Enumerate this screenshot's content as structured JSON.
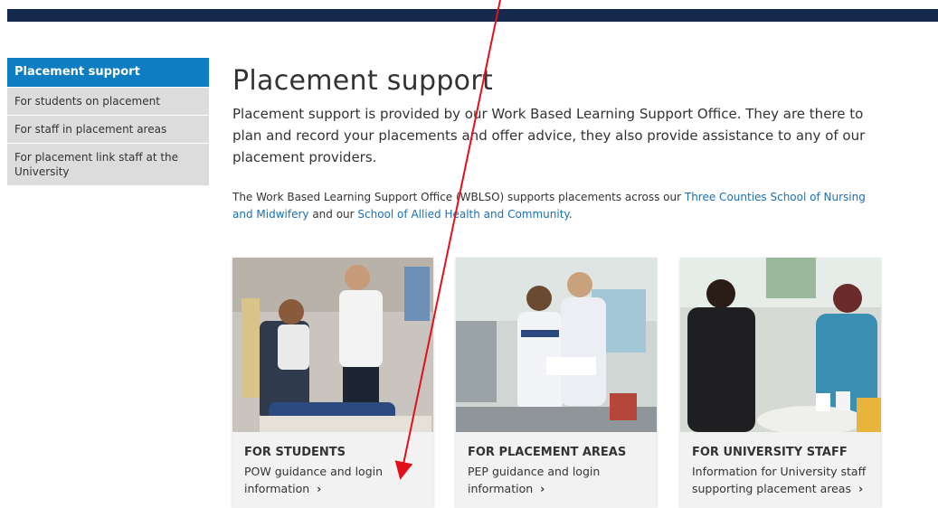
{
  "sidebar": {
    "items": [
      {
        "label": "Placement support"
      },
      {
        "label": "For students on placement"
      },
      {
        "label": "For staff in placement areas"
      },
      {
        "label": "For placement link staff at the University"
      }
    ]
  },
  "main": {
    "title": "Placement support",
    "intro": "Placement support is provided by our Work Based Learning Support Office. They are there to plan and record your placements and offer advice, they also provide assistance to any of our placement providers.",
    "sub_text_1": "The Work Based Learning Support Office (WBLSO) supports placements across our ",
    "sub_link_1": "Three Counties School of Nursing and Midwifery",
    "sub_text_2": " and our ",
    "sub_link_2": "School of Allied Health and Community",
    "sub_text_3": "."
  },
  "cards": [
    {
      "title": "For students",
      "text": "POW guidance and login information",
      "chevron": "›"
    },
    {
      "title": "For placement areas",
      "text": "PEP guidance and login information",
      "chevron": "›"
    },
    {
      "title": "For university staff",
      "text": "Information for University staff supporting placement areas",
      "chevron": "›"
    }
  ],
  "colors": {
    "top_bar": "#14294b",
    "sidebar_active": "#0e7dc2",
    "link": "#1a6fb5",
    "annotation_arrow": "#e3101a"
  }
}
